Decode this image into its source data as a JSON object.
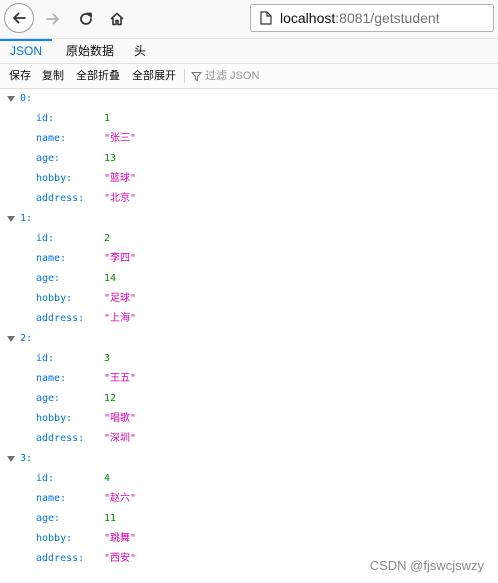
{
  "browser": {
    "url_host": "localhost",
    "url_rest": ":8081/getstudent"
  },
  "viewer": {
    "tabs": [
      "JSON",
      "原始数据",
      "头"
    ],
    "active_tab": "JSON",
    "toolbar": {
      "save": "保存",
      "copy": "复制",
      "collapse_all": "全部折叠",
      "expand_all": "全部展开",
      "filter_placeholder": "过滤 JSON"
    }
  },
  "students": [
    {
      "index": "0:",
      "id": "1",
      "name": "\"张三\"",
      "age": "13",
      "hobby": "\"篮球\"",
      "address": "\"北京\""
    },
    {
      "index": "1:",
      "id": "2",
      "name": "\"李四\"",
      "age": "14",
      "hobby": "\"足球\"",
      "address": "\"上海\""
    },
    {
      "index": "2:",
      "id": "3",
      "name": "\"王五\"",
      "age": "12",
      "hobby": "\"唱歌\"",
      "address": "\"深圳\""
    },
    {
      "index": "3:",
      "id": "4",
      "name": "\"赵六\"",
      "age": "11",
      "hobby": "\"跳舞\"",
      "address": "\"西安\""
    }
  ],
  "field_keys": {
    "id": "id:",
    "name": "name:",
    "age": "age:",
    "hobby": "hobby:",
    "address": "address:"
  },
  "colors": {
    "key": "#0074e8",
    "number": "#058b00",
    "string": "#dd00a9",
    "active_tab": "#0a84ff"
  },
  "watermark": "CSDN @fjswcjswzy"
}
